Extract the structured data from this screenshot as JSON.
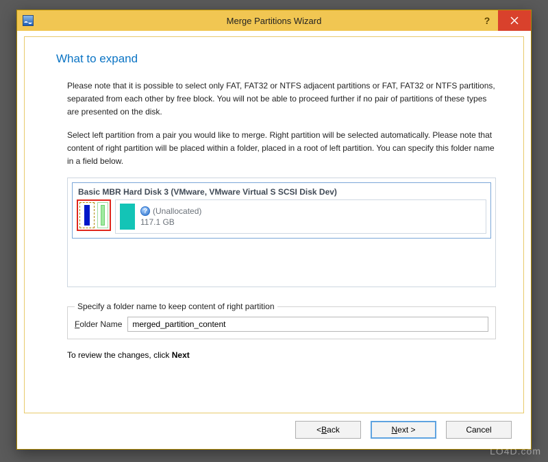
{
  "window": {
    "title": "Merge Partitions Wizard",
    "help_symbol": "?",
    "close_aria": "Close"
  },
  "heading": "What to expand",
  "paragraph1": "Please note that it is possible to select only FAT, FAT32 or NTFS adjacent partitions or FAT, FAT32 or NTFS partitions, separated from each other by free block. You will not be able to proceed further if no pair of partitions of these types are presented on the disk.",
  "paragraph2": "Select left partition from a pair you would like to merge. Right partition will be selected automatically. Please note that content of right partition will be placed within a folder, placed in a root of left partition. You can specify this folder name in a field below.",
  "disk": {
    "title": "Basic MBR Hard Disk 3 (VMware, VMware Virtual S SCSI Disk Dev)",
    "unallocated_label": "(Unallocated)",
    "unallocated_size": "117.1 GB"
  },
  "folder_section": {
    "legend": "Specify a folder name to keep content of right partition",
    "label_prefix": "F",
    "label_rest": "older Name",
    "value": "merged_partition_content"
  },
  "review_prefix": "To review the changes, click ",
  "review_bold": "Next",
  "buttons": {
    "back_arrow": "< ",
    "back_mn": "B",
    "back_rest": "ack",
    "next_mn": "N",
    "next_rest": "ext >",
    "cancel": "Cancel"
  },
  "watermark": "LO4D.com"
}
